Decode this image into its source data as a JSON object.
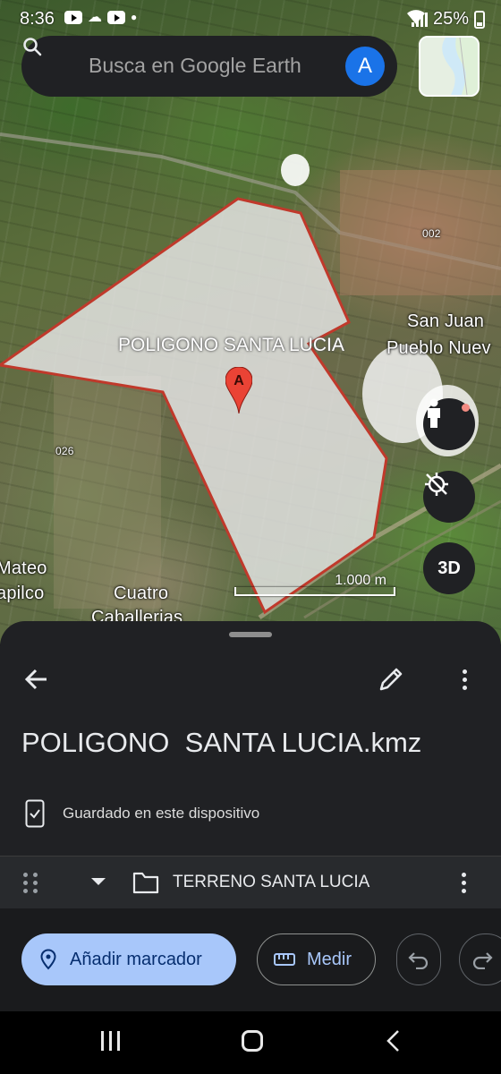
{
  "status_bar": {
    "time": "8:36",
    "battery": "25%"
  },
  "search": {
    "placeholder": "Busca en Google Earth",
    "avatar_letter": "A"
  },
  "map": {
    "polygon_label": "POLIGONO SANTA LUCIA",
    "marker_letter": "A",
    "place_labels": [
      {
        "text": "San Juan"
      },
      {
        "text": "Pueblo Nuev"
      },
      {
        "text": "Mateo"
      },
      {
        "text": "apilco"
      },
      {
        "text": "Cuatro"
      },
      {
        "text": "Caballerias"
      }
    ],
    "road_labels": [
      {
        "text": "002"
      },
      {
        "text": "026"
      }
    ],
    "scale_text": "1.000 m",
    "button_3d": "3D",
    "polygon_fill": "#e8e8e8",
    "polygon_stroke": "#c0392b"
  },
  "sheet": {
    "title": "POLIGONO  SANTA LUCIA.kmz",
    "saved_text": "Guardado en este dispositivo",
    "layer": {
      "name": "TERRENO SANTA LUCIA"
    }
  },
  "toolbar": {
    "add_marker_label": "Añadir marcador",
    "measure_label": "Medir",
    "accent": "#a8c7fa"
  }
}
